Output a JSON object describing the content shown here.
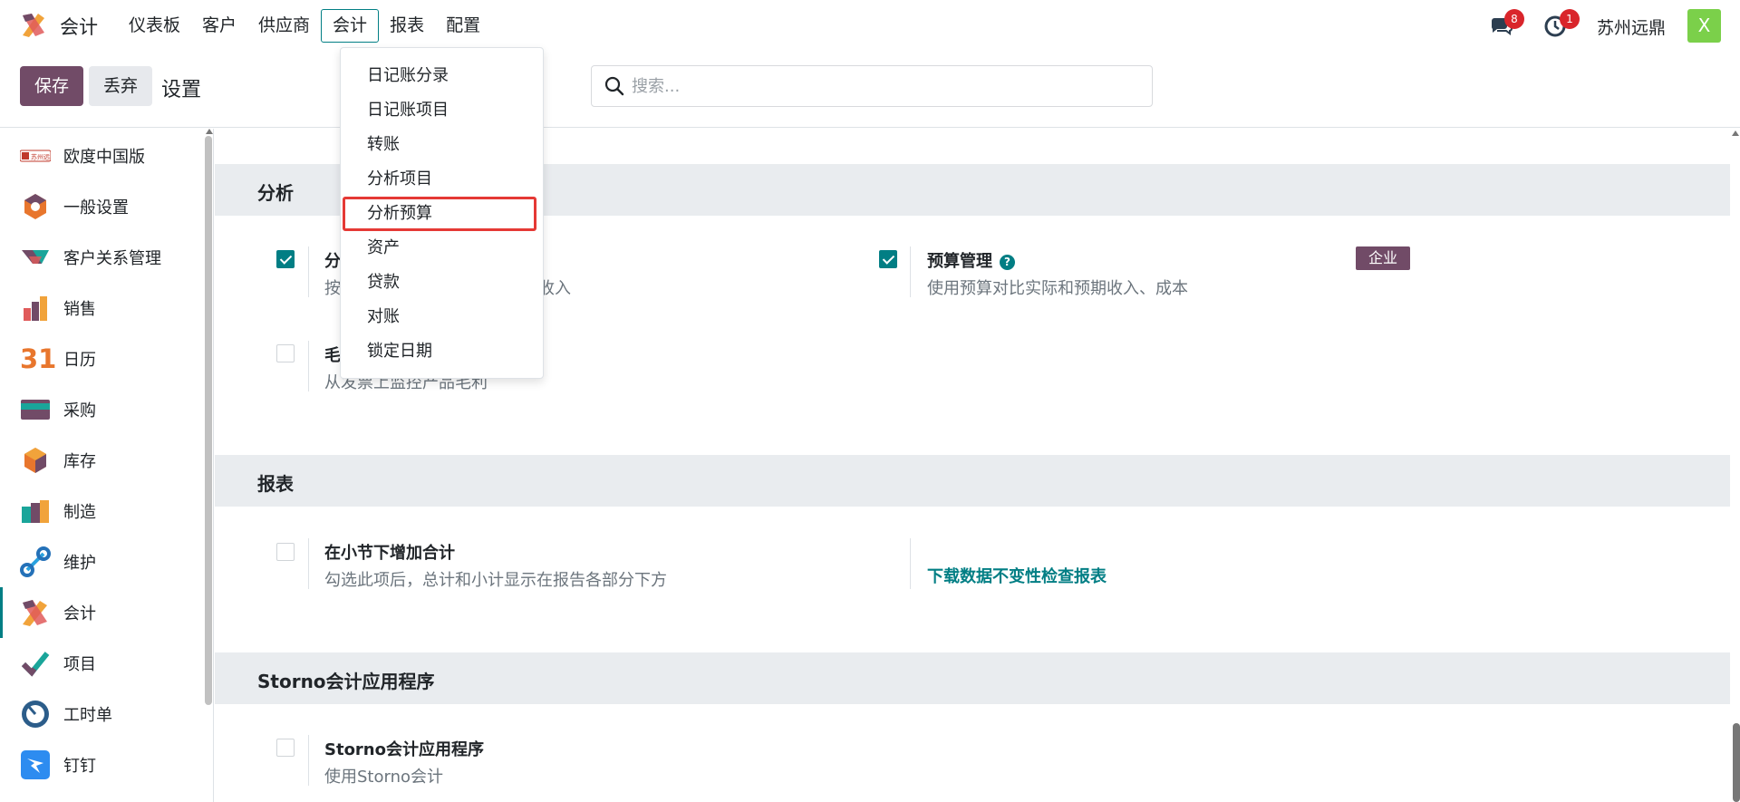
{
  "navbar": {
    "app_name": "会计",
    "menu": [
      "仪表板",
      "客户",
      "供应商",
      "会计",
      "报表",
      "配置"
    ],
    "messages_badge": "8",
    "activity_badge": "1",
    "company": "苏州远鼎",
    "avatar_letter": "X"
  },
  "control": {
    "save_label": "保存",
    "discard_label": "丢弃",
    "title": "设置",
    "search_placeholder": "搜索..."
  },
  "sidebar": {
    "items": [
      {
        "label": "欧度中国版",
        "icon": "odoo-china-icon"
      },
      {
        "label": "一般设置",
        "icon": "general-settings-icon"
      },
      {
        "label": "客户关系管理",
        "icon": "crm-icon"
      },
      {
        "label": "销售",
        "icon": "sales-icon"
      },
      {
        "label": "日历",
        "icon": "calendar-icon"
      },
      {
        "label": "采购",
        "icon": "purchase-icon"
      },
      {
        "label": "库存",
        "icon": "inventory-icon"
      },
      {
        "label": "制造",
        "icon": "manufacturing-icon"
      },
      {
        "label": "维护",
        "icon": "maintenance-icon"
      },
      {
        "label": "会计",
        "icon": "accounting-icon"
      },
      {
        "label": "项目",
        "icon": "project-icon"
      },
      {
        "label": "工时单",
        "icon": "timesheet-icon"
      },
      {
        "label": "钉钉",
        "icon": "dingtalk-icon"
      }
    ],
    "calendar_icon_text": "31",
    "brand_logo_text": "苏州远鼎"
  },
  "dropdown": {
    "items": [
      "日记账分录",
      "日记账项目",
      "转账",
      "分析项目",
      "分析预算",
      "资产",
      "贷款",
      "对账",
      "锁定日期"
    ]
  },
  "sections": {
    "analytics": {
      "title": "分析",
      "setting1_title_partial": "分",
      "setting1_desc_partial_start": "按",
      "setting1_desc_partial_end": "收入",
      "setting2_title": "预算管理",
      "setting2_desc": "使用预算对比实际和预期收入、成本",
      "enterprise_label": "企业",
      "setting3_title_partial": "毛",
      "setting3_desc": "从发票上监控产品毛利"
    },
    "reports": {
      "title": "报表",
      "setting1_title": "在小节下增加合计",
      "setting1_desc": "勾选此项后，总计和小计显示在报告各部分下方",
      "link": "下载数据不变性检查报表"
    },
    "storno": {
      "title": "Storno会计应用程序",
      "setting1_title": "Storno会计应用程序",
      "setting1_desc": "使用Storno会计"
    }
  },
  "colors": {
    "primary": "#714b67",
    "accent": "#017e84",
    "highlight": "#e53935"
  }
}
